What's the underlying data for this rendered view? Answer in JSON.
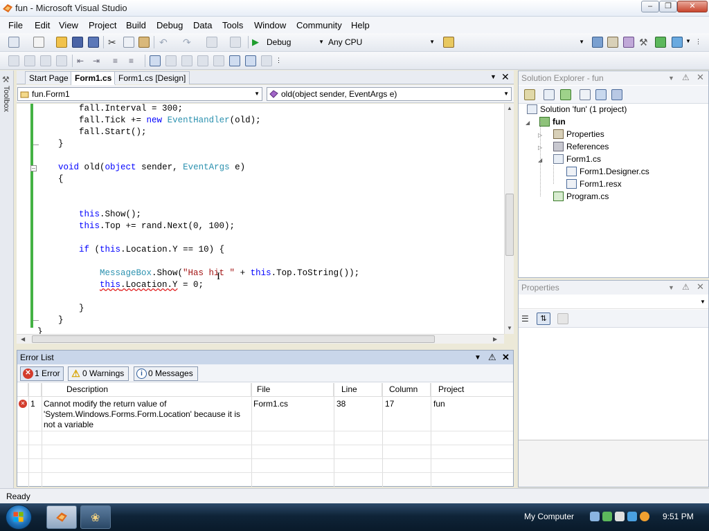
{
  "window": {
    "title": "fun - Microsoft Visual Studio"
  },
  "menu": [
    "File",
    "Edit",
    "View",
    "Project",
    "Build",
    "Debug",
    "Data",
    "Tools",
    "Window",
    "Community",
    "Help"
  ],
  "toolbar": {
    "config": "Debug",
    "platform": "Any CPU",
    "find": ""
  },
  "toolbox_label": "Toolbox",
  "doc_tabs": [
    {
      "label": "Start Page",
      "active": false
    },
    {
      "label": "Form1.cs",
      "active": true
    },
    {
      "label": "Form1.cs [Design]",
      "active": false
    }
  ],
  "nav": {
    "class_combo": "fun.Form1",
    "member_combo": "old(object sender, EventArgs e)"
  },
  "code_lines": [
    "        fall.Interval = 300;",
    "        fall.Tick += new EventHandler(old);",
    "        fall.Start();",
    "    }",
    "",
    "    void old(object sender, EventArgs e)",
    "    {",
    "",
    "",
    "        this.Show();",
    "        this.Top += rand.Next(0, 100);",
    "",
    "        if (this.Location.Y == 10) {",
    "",
    "            MessageBox.Show(\"Has hit \" + this.Top.ToString());",
    "            this.Location.Y = 0;",
    "",
    "        }",
    "    }",
    "}"
  ],
  "error_list": {
    "title": "Error List",
    "filters": {
      "errors": "1 Error",
      "warnings": "0 Warnings",
      "messages": "0 Messages"
    },
    "columns": {
      "description": "Description",
      "file": "File",
      "line": "Line",
      "column": "Column",
      "project": "Project"
    },
    "rows": [
      {
        "index": "1",
        "description": "Cannot modify the return value of 'System.Windows.Forms.Form.Location' because it is not a variable",
        "file": "Form1.cs",
        "line": "38",
        "column": "17",
        "project": "fun"
      }
    ]
  },
  "solution_explorer": {
    "title": "Solution Explorer - fun",
    "items": {
      "solution": "Solution 'fun' (1 project)",
      "project": "fun",
      "properties": "Properties",
      "references": "References",
      "form1": "Form1.cs",
      "designer": "Form1.Designer.cs",
      "resx": "Form1.resx",
      "program": "Program.cs"
    }
  },
  "properties": {
    "title": "Properties"
  },
  "status": {
    "text": "Ready"
  },
  "taskbar": {
    "tray_label": "My Computer",
    "clock": "9:51 PM"
  }
}
